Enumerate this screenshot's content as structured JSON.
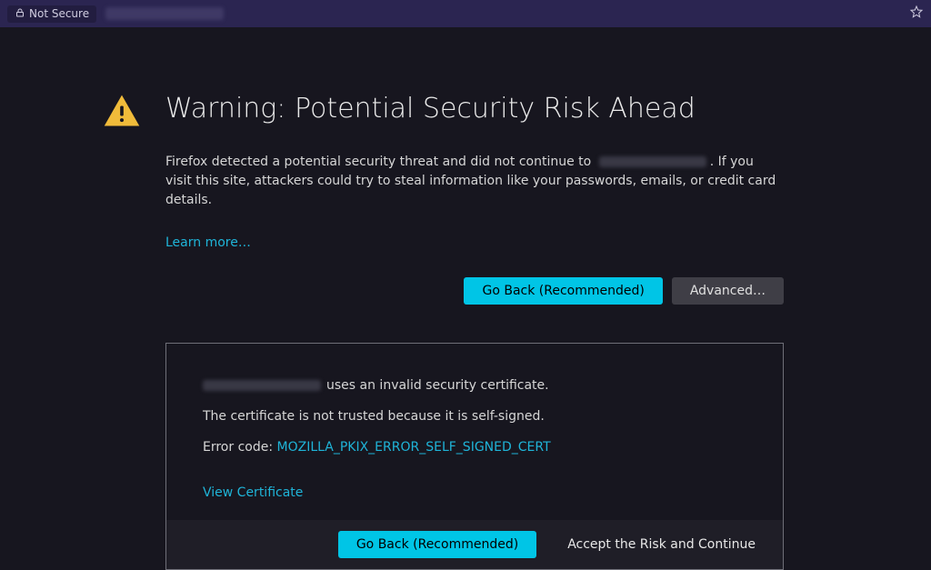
{
  "addressbar": {
    "security_label": "Not Secure"
  },
  "warning": {
    "title": "Warning: Potential Security Risk Ahead",
    "desc_before": "Firefox detected a potential security threat and did not continue to",
    "desc_after": ". If you visit this site, attackers could try to steal information like your passwords, emails, or credit card details.",
    "learn_more": "Learn more…",
    "go_back": "Go Back (Recommended)",
    "advanced": "Advanced…"
  },
  "advanced": {
    "line1_suffix": "uses an invalid security certificate.",
    "line2": "The certificate is not trusted because it is self-signed.",
    "error_label": "Error code: ",
    "error_code": "MOZILLA_PKIX_ERROR_SELF_SIGNED_CERT",
    "view_cert": "View Certificate",
    "go_back": "Go Back (Recommended)",
    "accept": "Accept the Risk and Continue"
  }
}
